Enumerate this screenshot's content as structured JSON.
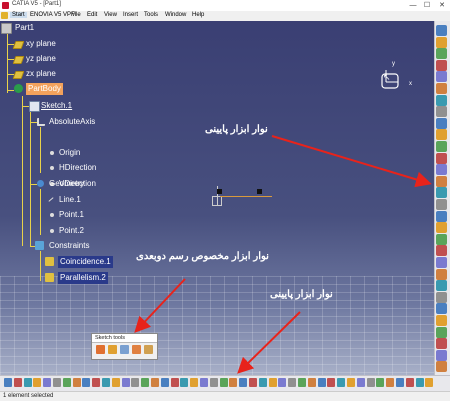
{
  "window": {
    "title": "CATIA V5 - [Part1]",
    "controls": [
      "—",
      "☐",
      "✕"
    ]
  },
  "menu": [
    {
      "label": "Start"
    },
    {
      "label": "ENOVIA V5 VPM"
    },
    {
      "label": "File"
    },
    {
      "label": "Edit"
    },
    {
      "label": "View"
    },
    {
      "label": "Insert"
    },
    {
      "label": "Tools"
    },
    {
      "label": "Window"
    },
    {
      "label": "Help"
    }
  ],
  "tree": {
    "root": "Part1",
    "planes": [
      "xy plane",
      "yz plane",
      "zx plane"
    ],
    "body": "PartBody",
    "sketch": "Sketch.1",
    "absolute_axis": "AbsoluteAxis",
    "axis_items": [
      "Origin",
      "HDirection",
      "VDirection"
    ],
    "geometry": "Geometry",
    "geometry_items": [
      "Line.1",
      "Point.1",
      "Point.2"
    ],
    "constraints": "Constraints",
    "constraint_items": [
      "Coincidence.1",
      "Parallelism.2"
    ]
  },
  "annotations": {
    "right_toolbar": "نوار ابزار پایینی",
    "sketch_toolbar": "نوار ابزار مخصوص رسم دوبعدی",
    "bottom_toolbar": "نوار ابزار پایینی"
  },
  "compass": {
    "axis_y": "y",
    "axis_x": "x",
    "glyph": "↖"
  },
  "sketch_tools": {
    "title": "Sketch tools"
  },
  "status": {
    "text": "1 element selected"
  },
  "colors": {
    "annotation_arrow": "#e8231b",
    "tree_line": "#e8d24a",
    "canvas_top": "#3a3f73"
  }
}
